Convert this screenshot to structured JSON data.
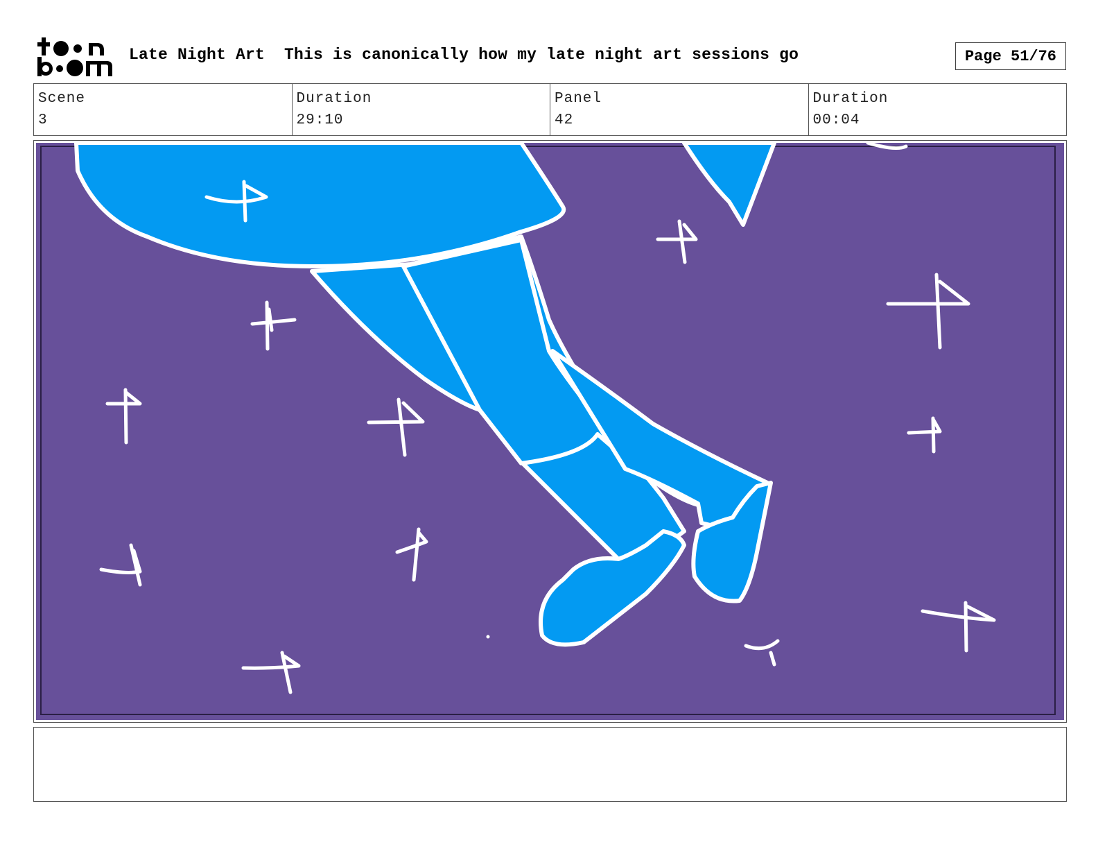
{
  "header": {
    "logo_text_top": "toon",
    "logo_text_bottom": "boom",
    "project_title": "Late Night Art",
    "subtitle": "This is canonically how my late night art sessions go",
    "page_label": "Page 51/76"
  },
  "info": [
    {
      "label": "Scene",
      "value": "3"
    },
    {
      "label": "Duration",
      "value": "29:10"
    },
    {
      "label": "Panel",
      "value": "42"
    },
    {
      "label": "Duration",
      "value": "00:04"
    }
  ],
  "panel": {
    "background_color": "#67509a",
    "fill_color": "#039af2",
    "line_color": "#ffffff",
    "depicts": "legs-crossed-sitting-among-stars"
  },
  "notes": {
    "text": ""
  }
}
